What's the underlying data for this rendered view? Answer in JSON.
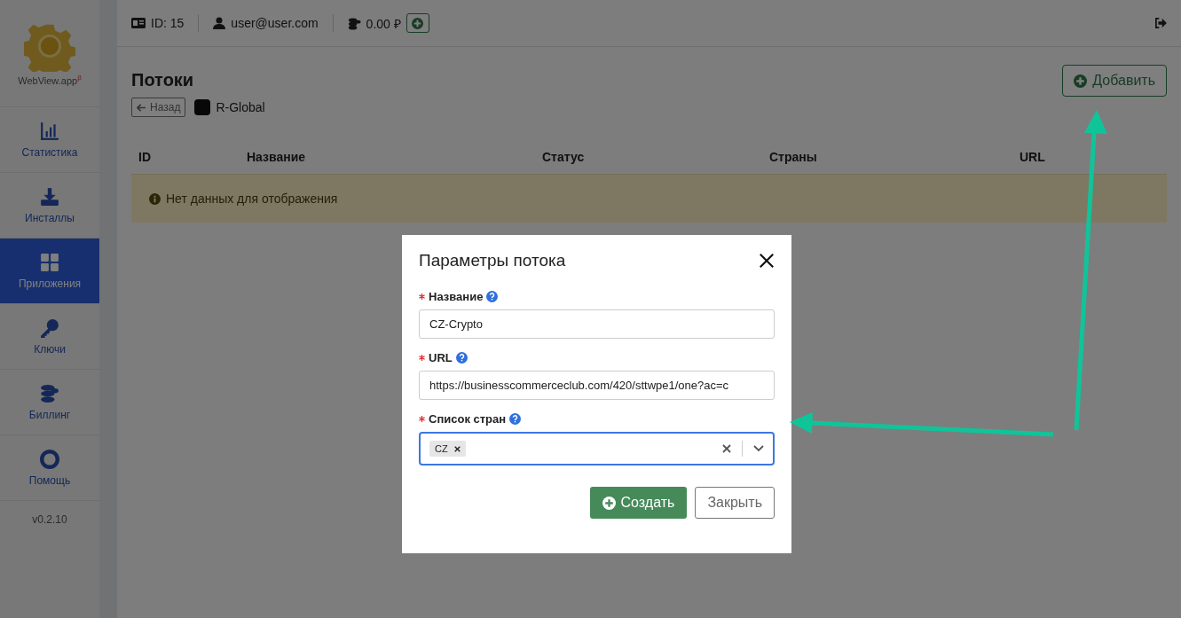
{
  "sidebar": {
    "logo_text": "WebView.app",
    "logo_mark": "β",
    "items": [
      {
        "label": "Статистика",
        "selected": false
      },
      {
        "label": "Инсталлы",
        "selected": false
      },
      {
        "label": "Приложения",
        "selected": true
      },
      {
        "label": "Ключи",
        "selected": false
      },
      {
        "label": "Биллинг",
        "selected": false
      },
      {
        "label": "Помощь",
        "selected": false
      }
    ],
    "version": "v0.2.10"
  },
  "top_bar": {
    "id": "ID: 15",
    "email": "user@user.com",
    "balance": "0.00 ₽"
  },
  "page": {
    "title": "Потоки",
    "back_button": "Назад",
    "app_name": "R-Global",
    "add_button": "Добавить",
    "table": {
      "columns": [
        "ID",
        "Название",
        "Статус",
        "Страны",
        "URL"
      ],
      "empty_message": "Нет данных для отображения"
    }
  },
  "modal": {
    "title": "Параметры потока",
    "fields": [
      {
        "kind": "text",
        "required": true,
        "label": "Название",
        "value": "CZ-Crypto"
      },
      {
        "kind": "text",
        "required": true,
        "label": "URL",
        "value": "https://businesscommerceclub.com/420/sttwpe1/one?ac=c"
      },
      {
        "kind": "tags",
        "required": true,
        "label": "Список стран",
        "tags": [
          "CZ"
        ]
      }
    ],
    "submit_button": "Создать",
    "close_button": "Закрыть"
  }
}
